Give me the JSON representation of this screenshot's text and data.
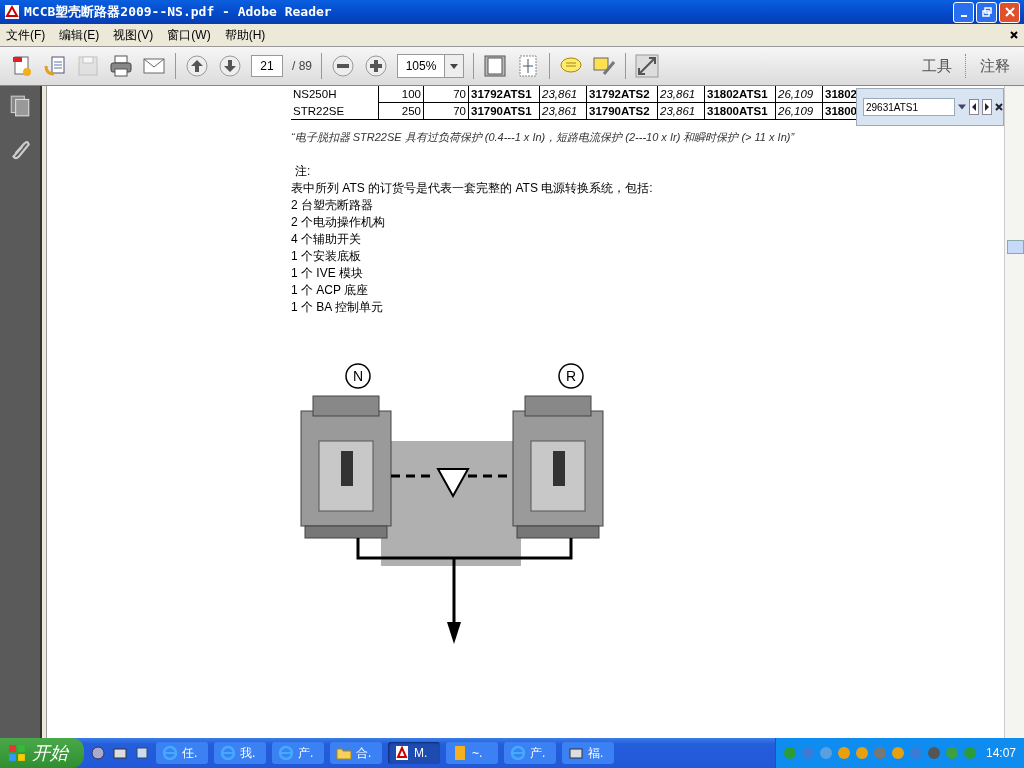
{
  "window": {
    "title": "MCCB塑壳断路器2009--NS.pdf - Adobe Reader"
  },
  "menu": [
    {
      "label": "文件(F)"
    },
    {
      "label": "编辑(E)"
    },
    {
      "label": "视图(V)"
    },
    {
      "label": "窗口(W)"
    },
    {
      "label": "帮助(H)"
    }
  ],
  "toolbar": {
    "page": "21",
    "page_total": "/ 89",
    "zoom": "105%",
    "tools": "工具",
    "comments": "注释"
  },
  "table": {
    "rows": [
      {
        "cells": [
          "NS250H",
          "100",
          "70",
          "31792ATS1",
          "23,861",
          "31792ATS2",
          "23,861",
          "31802ATS1",
          "26,109",
          "31802"
        ]
      },
      {
        "cells": [
          "STR22SE",
          "250",
          "70",
          "31790ATS1",
          "23,861",
          "31790ATS2",
          "23,861",
          "31800ATS1",
          "26,109",
          "31800"
        ]
      }
    ]
  },
  "footnote": "“电子脱扣器 STR22SE 具有过负荷保护 (0.4---1 x In)，短路电流保护 (2---10 x Ir) 和瞬时保护 (> 11 x In)”",
  "notes": [
    "注:",
    "表中所列 ATS 的订货号是代表一套完整的 ATS 电源转换系统，包括:",
    "2 台塑壳断路器",
    "2 个电动操作机构",
    "4 个辅助开关",
    "1 个安装底板",
    "1 个 IVE 模块",
    "1 个 ACP 底座",
    "1 个 BA 控制单元"
  ],
  "diagram": {
    "left_label": "N",
    "right_label": "R"
  },
  "find": {
    "value": "29631ATS1"
  },
  "taskbar": {
    "start": "开始",
    "tasks": [
      {
        "label": "任.",
        "kind": "browser",
        "selected": false
      },
      {
        "label": "我.",
        "kind": "browser",
        "selected": false
      },
      {
        "label": "产.",
        "kind": "browser",
        "selected": false
      },
      {
        "label": "合.",
        "kind": "folder",
        "selected": false
      },
      {
        "label": "M.",
        "kind": "reader",
        "selected": true
      },
      {
        "label": "~.",
        "kind": "note",
        "selected": false
      },
      {
        "label": "产.",
        "kind": "browser",
        "selected": false
      },
      {
        "label": "福.",
        "kind": "app",
        "selected": false
      }
    ],
    "clock": "14:07"
  }
}
